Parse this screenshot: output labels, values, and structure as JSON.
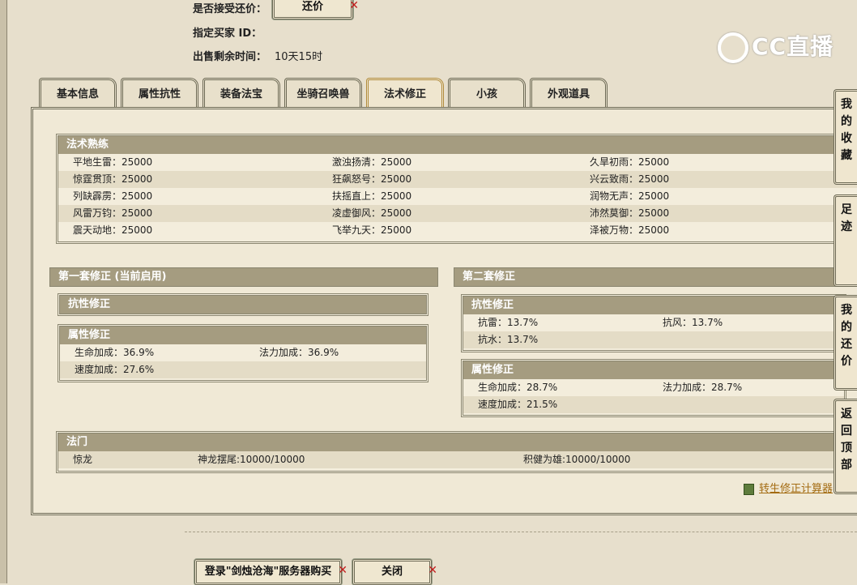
{
  "top": {
    "accept_label": "是否接受还价：",
    "counter_button": "还价",
    "buyer_label": "指定买家 ID：",
    "time_label": "出售剩余时间：",
    "time_value": "10天15时"
  },
  "logo_text": "CC直播",
  "tabs": [
    "基本信息",
    "属性抗性",
    "装备法宝",
    "坐骑召唤兽",
    "法术修正",
    "小孩",
    "外观道具"
  ],
  "spell_mastery": {
    "title": "法术熟练",
    "rows": [
      [
        "平地生雷：25000",
        "激浊扬清：25000",
        "久旱初雨：25000"
      ],
      [
        "惊霆贯顶：25000",
        "狂飙怒号：25000",
        "兴云致雨：25000"
      ],
      [
        "列缺霹雳：25000",
        "扶摇直上：25000",
        "润物无声：25000"
      ],
      [
        "风雷万钧：25000",
        "凌虚御风：25000",
        "沛然莫御：25000"
      ],
      [
        "震天动地：25000",
        "飞举九天：25000",
        "泽被万物：25000"
      ]
    ]
  },
  "set1": {
    "title": "第一套修正 (当前启用)",
    "resist_title": "抗性修正",
    "attr_title": "属性修正",
    "attr_rows": [
      [
        "生命加成：36.9%",
        "法力加成：36.9%"
      ],
      [
        "速度加成：27.6%",
        ""
      ]
    ]
  },
  "set2": {
    "title": "第二套修正",
    "resist_title": "抗性修正",
    "resist_rows": [
      [
        "抗雷：13.7%",
        "抗风：13.7%"
      ],
      [
        "抗水：13.7%",
        ""
      ]
    ],
    "attr_title": "属性修正",
    "attr_rows": [
      [
        "生命加成：28.7%",
        "法力加成：28.7%"
      ],
      [
        "速度加成：21.5%",
        ""
      ]
    ]
  },
  "famen": {
    "title": "法门",
    "row": [
      "惊龙",
      "神龙摆尾:10000/10000",
      "积健为雄:10000/10000"
    ]
  },
  "calc_link": "转生修正计算器",
  "side": {
    "fav": "我的收藏",
    "foot": "足迹",
    "bargain": "我的还价",
    "top": "返回顶部"
  },
  "bottom": {
    "login_button": "登录\"剑烛沧海\"服务器购买",
    "close_button": "关闭"
  }
}
